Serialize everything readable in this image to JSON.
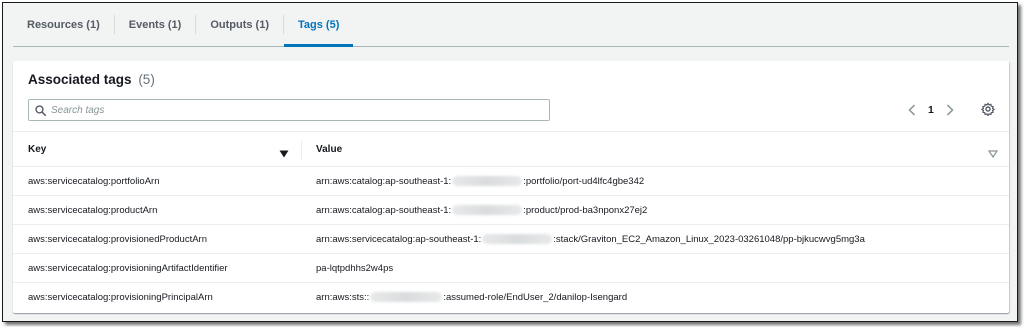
{
  "tabs": [
    {
      "label": "Resources (1)",
      "active": false
    },
    {
      "label": "Events (1)",
      "active": false
    },
    {
      "label": "Outputs (1)",
      "active": false
    },
    {
      "label": "Tags (5)",
      "active": true
    }
  ],
  "panel": {
    "title": "Associated tags",
    "count": "(5)"
  },
  "search": {
    "placeholder": "Search tags",
    "value": "",
    "icon": "search-icon"
  },
  "pagination": {
    "current_page": "1",
    "prev_icon": "chevron-left-icon",
    "next_icon": "chevron-right-icon"
  },
  "settings_icon": "gear-icon",
  "table": {
    "columns": [
      "Key",
      "Value"
    ],
    "rows": [
      {
        "key": "aws:servicecatalog:portfolioArn",
        "value_prefix": "arn:aws:catalog:ap-southeast-1:",
        "value_suffix": ":portfolio/port-ud4lfc4gbe342",
        "redacted": true
      },
      {
        "key": "aws:servicecatalog:productArn",
        "value_prefix": "arn:aws:catalog:ap-southeast-1:",
        "value_suffix": ":product/prod-ba3nponx27ej2",
        "redacted": true
      },
      {
        "key": "aws:servicecatalog:provisionedProductArn",
        "value_prefix": "arn:aws:servicecatalog:ap-southeast-1:",
        "value_suffix": ":stack/Graviton_EC2_Amazon_Linux_2023-03261048/pp-bjkucwvg5mg3a",
        "redacted": true
      },
      {
        "key": "aws:servicecatalog:provisioningArtifactIdentifier",
        "value_prefix": "pa-lqtpdhhs2w4ps",
        "value_suffix": "",
        "redacted": false
      },
      {
        "key": "aws:servicecatalog:provisioningPrincipalArn",
        "value_prefix": "arn:aws:sts::",
        "value_suffix": ":assumed-role/EndUser_2/danilop-Isengard",
        "redacted": true
      }
    ]
  },
  "colors": {
    "accent": "#0073bb",
    "text": "#16191f",
    "muted": "#545b64",
    "border": "#eaeded"
  }
}
